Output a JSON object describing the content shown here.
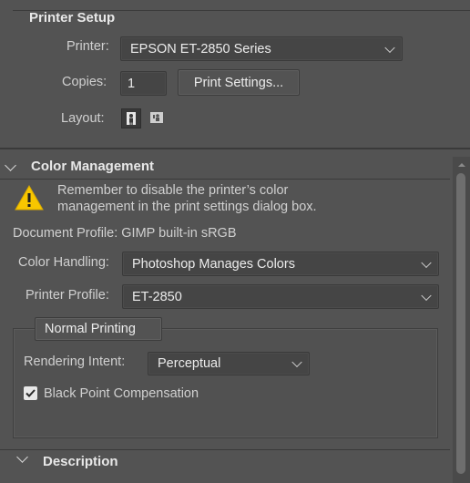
{
  "printer_setup": {
    "title": "Printer Setup",
    "printer_label": "Printer:",
    "printer_value": "EPSON ET-2850 Series",
    "copies_label": "Copies:",
    "copies_value": "1",
    "print_settings_button": "Print Settings...",
    "layout_label": "Layout:"
  },
  "color_management": {
    "title": "Color Management",
    "warning_text_line1": "Remember to disable the printer’s color",
    "warning_text_line2": "management in the print settings dialog box.",
    "document_profile": "Document Profile: GIMP built-in sRGB",
    "color_handling_label": "Color Handling:",
    "color_handling_value": "Photoshop Manages Colors",
    "printer_profile_label": "Printer Profile:",
    "printer_profile_value": "ET-2850",
    "printing_mode_value": "Normal Printing",
    "rendering_intent_label": "Rendering Intent:",
    "rendering_intent_value": "Perceptual",
    "black_point_label": "Black Point Compensation",
    "black_point_checked": true
  },
  "description": {
    "title": "Description"
  }
}
